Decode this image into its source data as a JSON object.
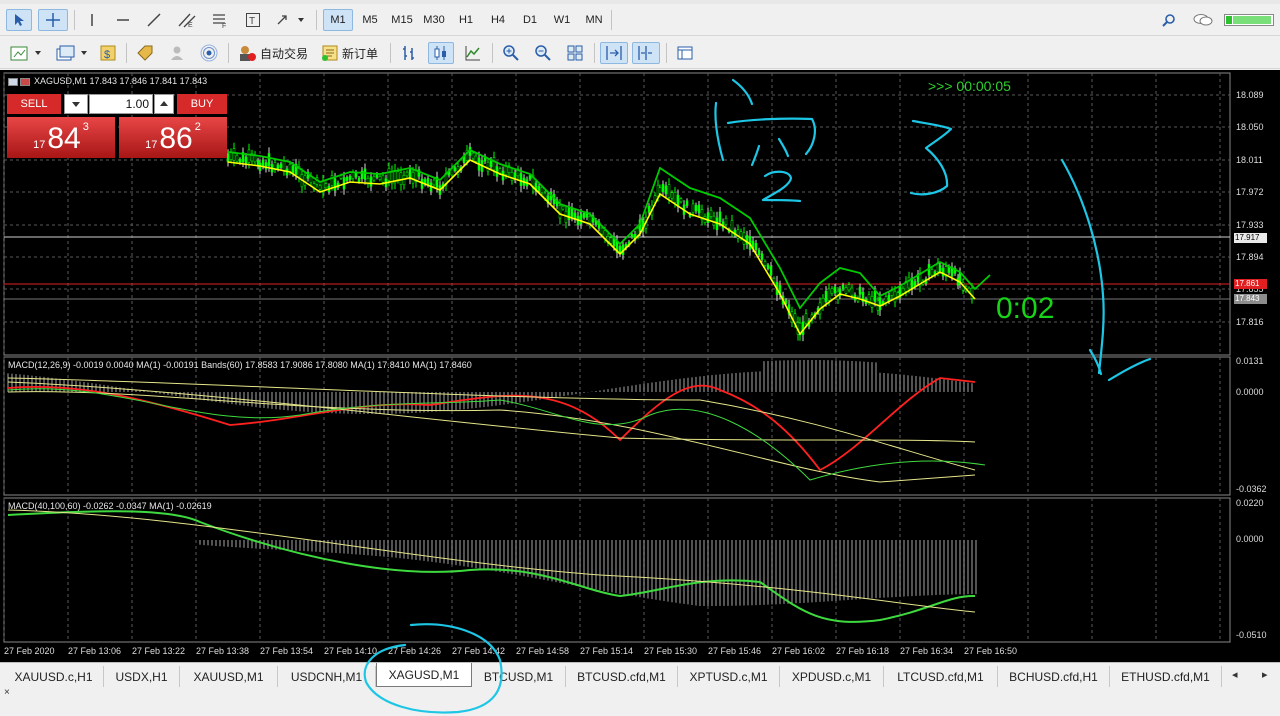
{
  "toolbar": {
    "timeframes": [
      "M1",
      "M5",
      "M15",
      "M30",
      "H1",
      "H4",
      "D1",
      "W1",
      "MN"
    ],
    "active_timeframe": "M1",
    "auto_trade_label": "自动交易",
    "new_order_label": "新订单"
  },
  "chart": {
    "title": "XAGUSD,M1  17.843 17.846 17.841 17.843",
    "countdown": ">>> 00:00:05",
    "timer_overlay": "0:02",
    "price_labels": [
      "18.089",
      "18.050",
      "18.011",
      "17.972",
      "17.933",
      "17.894",
      "17.855",
      "17.816"
    ],
    "marker_labels": {
      "line": "17.917",
      "bid": "17.843",
      "ask_red": "17.861"
    },
    "time_labels": [
      "27 Feb 2020",
      "27 Feb 13:06",
      "27 Feb 13:22",
      "27 Feb 13:38",
      "27 Feb 13:54",
      "27 Feb 14:10",
      "27 Feb 14:26",
      "27 Feb 14:42",
      "27 Feb 14:58",
      "27 Feb 15:14",
      "27 Feb 15:30",
      "27 Feb 15:46",
      "27 Feb 16:02",
      "27 Feb 16:18",
      "27 Feb 16:34",
      "27 Feb 16:50"
    ],
    "macd1": {
      "title": "MACD(12,26,9) -0.0019 0.0040 MA(1) -0.00191 Bands(60) 17.8583 17.9086 17.8080 MA(1) 17.8410 MA(1) 17.8460",
      "labels": [
        "0.0131",
        "0.0000",
        "-0.0362"
      ]
    },
    "macd2": {
      "title": "MACD(40,100,60) -0.0262 -0.0347 MA(1) -0.02619",
      "labels": [
        "0.0220",
        "0.0000",
        "-0.0510"
      ]
    },
    "handwriting": [
      "1",
      "2",
      "3"
    ]
  },
  "trade": {
    "sell_label": "SELL",
    "buy_label": "BUY",
    "lot": "1.00",
    "sell_price": {
      "prefix": "17",
      "big": "84",
      "sup": "3"
    },
    "buy_price": {
      "prefix": "17",
      "big": "86",
      "sup": "2"
    }
  },
  "tabs": [
    "XAUUSD.c,H1",
    "USDX,H1",
    "XAUUSD,M1",
    "USDCNH,M1",
    "XAGUSD,M1",
    "BTCUSD,M1",
    "BTCUSD.cfd,M1",
    "XPTUSD.c,M1",
    "XPDUSD.c,M1",
    "LTCUSD.cfd,M1",
    "BCHUSD.cfd,H1",
    "ETHUSD.cfd,M1"
  ],
  "active_tab": "XAGUSD,M1",
  "colors": {
    "up_candle": "#00ff00",
    "ma_fast": "#ffff00",
    "ma_slow": "#00cc00",
    "macd_signal": "#ff2020",
    "annotation": "#1ec6e6",
    "grid": "#5a5a5a"
  }
}
